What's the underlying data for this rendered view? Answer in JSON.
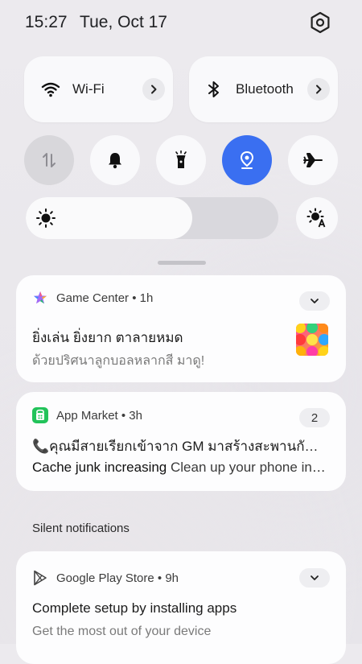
{
  "status": {
    "time": "15:27",
    "date": "Tue, Oct 17"
  },
  "tiles": {
    "wifi_label": "Wi-Fi",
    "bluetooth_label": "Bluetooth"
  },
  "brightness": {
    "level": 0.66
  },
  "notifications": [
    {
      "app": "Game Center",
      "time": "1h",
      "title": "ยิ่งเล่น ยิ่งยาก ตาลายหมด",
      "body": "ด้วยปริศนาลูกบอลหลากสี มาดู!"
    },
    {
      "app": "App Market",
      "time": "3h",
      "count": "2",
      "line1": "📞คุณมีสายเรียกเข้าจาก GM มาสร้างสะพานกันเถอะ",
      "line2_bold": "Cache junk increasing",
      "line2_rest": "Clean up your phone in no time"
    },
    {
      "app": "Google Play Store",
      "time": "9h",
      "title": "Complete setup by installing apps",
      "body": "Get the most out of your device"
    }
  ],
  "silent_header": "Silent notifications",
  "colors": {
    "accent": "#3a6ff1",
    "tile_bg": "#f9f9fb",
    "market_green": "#22c35a"
  }
}
